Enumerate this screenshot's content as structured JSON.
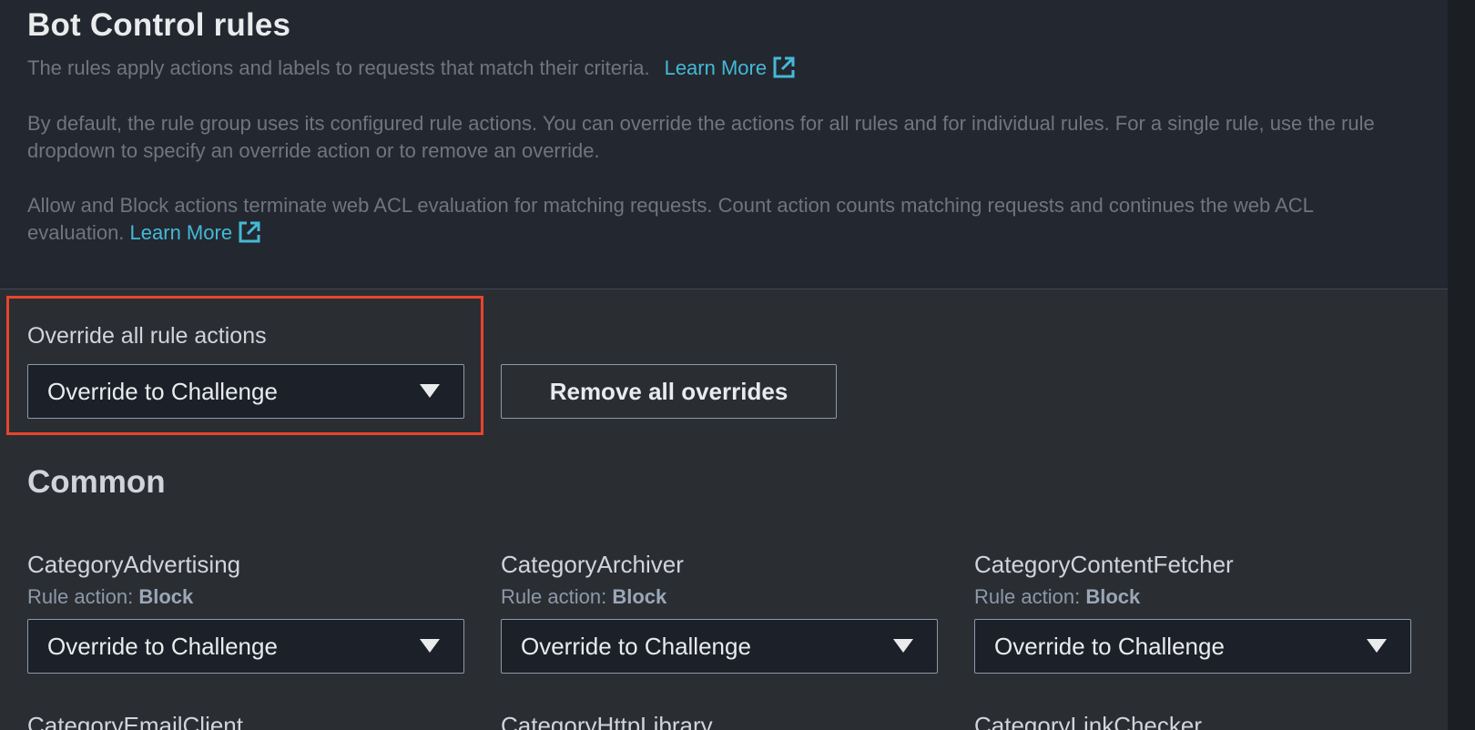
{
  "header": {
    "title": "Bot Control rules",
    "desc1": "The rules apply actions and labels to requests that match their criteria.",
    "desc1_link": "Learn More",
    "desc2": "By default, the rule group uses its configured rule actions. You can override the actions for all rules and for individual rules. For a single rule, use the rule dropdown to specify an override action or to remove an override.",
    "desc3": "Allow and Block actions terminate web ACL evaluation for matching requests. Count action counts matching requests and continues the web ACL evaluation.",
    "desc3_link": "Learn More"
  },
  "override_all": {
    "label": "Override all rule actions",
    "selected": "Override to Challenge",
    "remove_button": "Remove all overrides",
    "highlight_color": "#e8452c"
  },
  "section": {
    "title": "Common"
  },
  "rules": [
    {
      "name": "CategoryAdvertising",
      "action_prefix": "Rule action:",
      "action": "Block",
      "selected": "Override to Challenge"
    },
    {
      "name": "CategoryArchiver",
      "action_prefix": "Rule action:",
      "action": "Block",
      "selected": "Override to Challenge"
    },
    {
      "name": "CategoryContentFetcher",
      "action_prefix": "Rule action:",
      "action": "Block",
      "selected": "Override to Challenge"
    },
    {
      "name": "CategoryEmailClient"
    },
    {
      "name": "CategoryHttpLibrary"
    },
    {
      "name": "CategoryLinkChecker"
    }
  ],
  "colors": {
    "link": "#44b9d6",
    "background": "#2a2e33",
    "header_background": "#232730"
  }
}
